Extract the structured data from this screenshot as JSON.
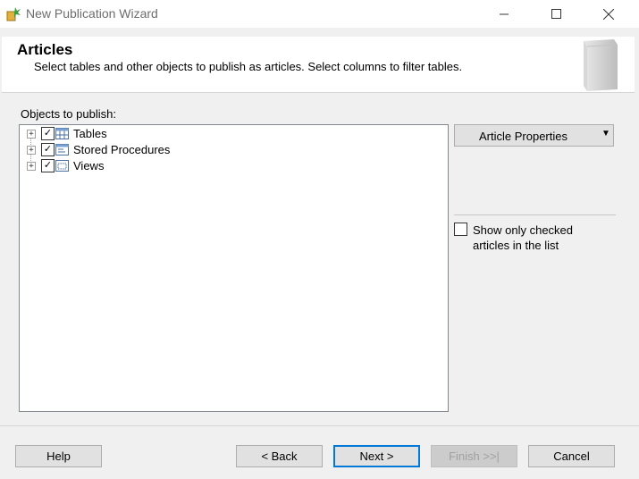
{
  "window": {
    "title": "New Publication Wizard"
  },
  "header": {
    "title": "Articles",
    "subtitle": "Select tables and other objects to publish as articles. Select columns to filter tables."
  },
  "objects_label": "Objects to publish:",
  "tree": {
    "items": [
      {
        "label": "Tables",
        "checked": true,
        "icon": "table-icon"
      },
      {
        "label": "Stored Procedures",
        "checked": true,
        "icon": "stored-procedure-icon"
      },
      {
        "label": "Views",
        "checked": true,
        "icon": "view-icon"
      }
    ]
  },
  "article_properties_label": "Article Properties",
  "show_only_checked": {
    "line1": "Show only checked",
    "line2": "articles in the list",
    "checked": false
  },
  "buttons": {
    "help": "Help",
    "back": "< Back",
    "next": "Next >",
    "finish": "Finish >>|",
    "cancel": "Cancel"
  },
  "colors": {
    "accent": "#0078d7",
    "disabled_text": "#a0a0a0"
  }
}
